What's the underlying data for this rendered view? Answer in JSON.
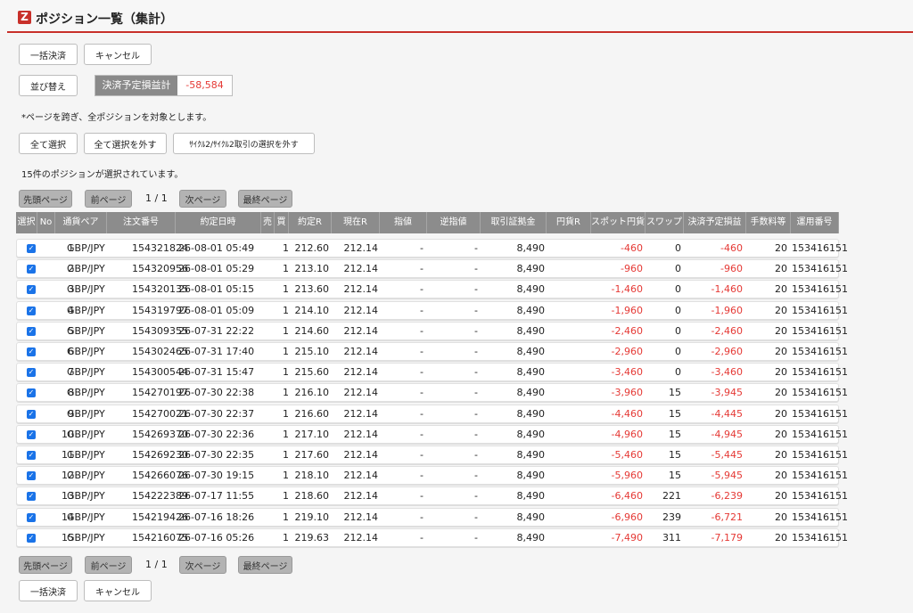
{
  "header": {
    "logo_letter": "Z",
    "title": "ポジション一覧（集計）"
  },
  "top_buttons": {
    "bulk_settle": "一括決済",
    "cancel": "キャンセル"
  },
  "sort_button": "並び替え",
  "pl_summary": {
    "label": "決済予定損益計",
    "value": "-58,584"
  },
  "note": "*ページを跨ぎ、全ポジションを対象とします。",
  "select_buttons": {
    "select_all": "全て選択",
    "deselect_all": "全て選択を外す",
    "deselect_cycle": "ｻｲｸﾙ2/ｻｲｸﾙ2取引の選択を外す"
  },
  "selected_count": "15件のポジションが選択されています。",
  "pager": {
    "first": "先頭ページ",
    "prev": "前ページ",
    "page_indicator": "1 / 1",
    "next": "次ページ",
    "last": "最終ページ"
  },
  "table": {
    "headers": [
      "選択",
      "No",
      "通貨ペア",
      "注文番号",
      "約定日時",
      "売",
      "買",
      "約定R",
      "現在R",
      "指値",
      "逆指値",
      "取引証拠金",
      "円貨R",
      "スポット円貨",
      "スワップ",
      "決済予定損益",
      "手数料等",
      "運用番号"
    ],
    "rows": [
      {
        "no": "1",
        "pair": "GBP/JPY",
        "order": "154321824",
        "dt": "26-08-01 05:49",
        "buy": "1",
        "rate": "212.60",
        "cur": "212.14",
        "limit": "-",
        "stop": "-",
        "margin": "8,490",
        "spot": "-460",
        "swap": "0",
        "pl": "-460",
        "fee": "20",
        "op": "153416151"
      },
      {
        "no": "2",
        "pair": "GBP/JPY",
        "order": "154320956",
        "dt": "26-08-01 05:29",
        "buy": "1",
        "rate": "213.10",
        "cur": "212.14",
        "limit": "-",
        "stop": "-",
        "margin": "8,490",
        "spot": "-960",
        "swap": "0",
        "pl": "-960",
        "fee": "20",
        "op": "153416151"
      },
      {
        "no": "3",
        "pair": "GBP/JPY",
        "order": "154320135",
        "dt": "26-08-01 05:15",
        "buy": "1",
        "rate": "213.60",
        "cur": "212.14",
        "limit": "-",
        "stop": "-",
        "margin": "8,490",
        "spot": "-1,460",
        "swap": "0",
        "pl": "-1,460",
        "fee": "20",
        "op": "153416151"
      },
      {
        "no": "4",
        "pair": "GBP/JPY",
        "order": "154319797",
        "dt": "26-08-01 05:09",
        "buy": "1",
        "rate": "214.10",
        "cur": "212.14",
        "limit": "-",
        "stop": "-",
        "margin": "8,490",
        "spot": "-1,960",
        "swap": "0",
        "pl": "-1,960",
        "fee": "20",
        "op": "153416151"
      },
      {
        "no": "5",
        "pair": "GBP/JPY",
        "order": "154309355",
        "dt": "26-07-31 22:22",
        "buy": "1",
        "rate": "214.60",
        "cur": "212.14",
        "limit": "-",
        "stop": "-",
        "margin": "8,490",
        "spot": "-2,460",
        "swap": "0",
        "pl": "-2,460",
        "fee": "20",
        "op": "153416151"
      },
      {
        "no": "6",
        "pair": "GBP/JPY",
        "order": "154302465",
        "dt": "26-07-31 17:40",
        "buy": "1",
        "rate": "215.10",
        "cur": "212.14",
        "limit": "-",
        "stop": "-",
        "margin": "8,490",
        "spot": "-2,960",
        "swap": "0",
        "pl": "-2,960",
        "fee": "20",
        "op": "153416151"
      },
      {
        "no": "7",
        "pair": "GBP/JPY",
        "order": "154300544",
        "dt": "26-07-31 15:47",
        "buy": "1",
        "rate": "215.60",
        "cur": "212.14",
        "limit": "-",
        "stop": "-",
        "margin": "8,490",
        "spot": "-3,460",
        "swap": "0",
        "pl": "-3,460",
        "fee": "20",
        "op": "153416151"
      },
      {
        "no": "8",
        "pair": "GBP/JPY",
        "order": "154270197",
        "dt": "26-07-30 22:38",
        "buy": "1",
        "rate": "216.10",
        "cur": "212.14",
        "limit": "-",
        "stop": "-",
        "margin": "8,490",
        "spot": "-3,960",
        "swap": "15",
        "pl": "-3,945",
        "fee": "20",
        "op": "153416151"
      },
      {
        "no": "9",
        "pair": "GBP/JPY",
        "order": "154270021",
        "dt": "26-07-30 22:37",
        "buy": "1",
        "rate": "216.60",
        "cur": "212.14",
        "limit": "-",
        "stop": "-",
        "margin": "8,490",
        "spot": "-4,460",
        "swap": "15",
        "pl": "-4,445",
        "fee": "20",
        "op": "153416151"
      },
      {
        "no": "10",
        "pair": "GBP/JPY",
        "order": "154269370",
        "dt": "26-07-30 22:36",
        "buy": "1",
        "rate": "217.10",
        "cur": "212.14",
        "limit": "-",
        "stop": "-",
        "margin": "8,490",
        "spot": "-4,960",
        "swap": "15",
        "pl": "-4,945",
        "fee": "20",
        "op": "153416151"
      },
      {
        "no": "11",
        "pair": "GBP/JPY",
        "order": "154269230",
        "dt": "26-07-30 22:35",
        "buy": "1",
        "rate": "217.60",
        "cur": "212.14",
        "limit": "-",
        "stop": "-",
        "margin": "8,490",
        "spot": "-5,460",
        "swap": "15",
        "pl": "-5,445",
        "fee": "20",
        "op": "153416151"
      },
      {
        "no": "12",
        "pair": "GBP/JPY",
        "order": "154266076",
        "dt": "26-07-30 19:15",
        "buy": "1",
        "rate": "218.10",
        "cur": "212.14",
        "limit": "-",
        "stop": "-",
        "margin": "8,490",
        "spot": "-5,960",
        "swap": "15",
        "pl": "-5,945",
        "fee": "20",
        "op": "153416151"
      },
      {
        "no": "13",
        "pair": "GBP/JPY",
        "order": "154222389",
        "dt": "26-07-17 11:55",
        "buy": "1",
        "rate": "218.60",
        "cur": "212.14",
        "limit": "-",
        "stop": "-",
        "margin": "8,490",
        "spot": "-6,460",
        "swap": "221",
        "pl": "-6,239",
        "fee": "20",
        "op": "153416151"
      },
      {
        "no": "14",
        "pair": "GBP/JPY",
        "order": "154219426",
        "dt": "26-07-16 18:26",
        "buy": "1",
        "rate": "219.10",
        "cur": "212.14",
        "limit": "-",
        "stop": "-",
        "margin": "8,490",
        "spot": "-6,960",
        "swap": "239",
        "pl": "-6,721",
        "fee": "20",
        "op": "153416151"
      },
      {
        "no": "15",
        "pair": "GBP/JPY",
        "order": "154216075",
        "dt": "26-07-16 05:26",
        "buy": "1",
        "rate": "219.63",
        "cur": "212.14",
        "limit": "-",
        "stop": "-",
        "margin": "8,490",
        "spot": "-7,490",
        "swap": "311",
        "pl": "-7,179",
        "fee": "20",
        "op": "153416151"
      }
    ]
  },
  "colors": {
    "accent_red": "#c8302a",
    "negative": "#e53935",
    "header_gray": "#8c8c8c",
    "checkbox_blue": "#1a73e8"
  },
  "icons": {
    "checkbox": "checkbox-checked-icon",
    "logo": "brand-logo-icon"
  }
}
